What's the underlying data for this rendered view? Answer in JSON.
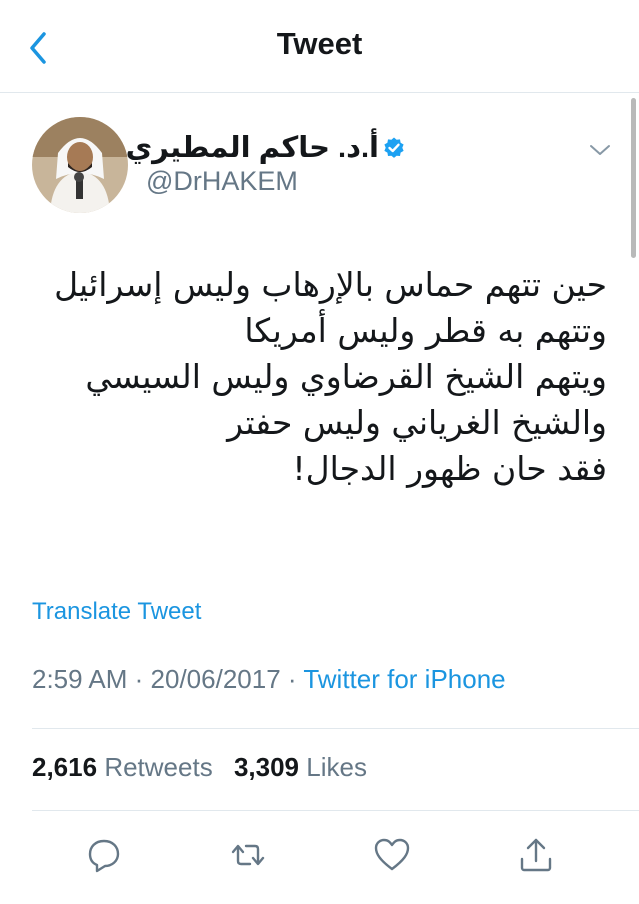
{
  "header": {
    "back_icon": "chevron-left-icon",
    "title": "Tweet"
  },
  "author": {
    "display_name": "أ.د. حاكم المطيري",
    "handle": "@DrHAKEM",
    "verified_icon": "verified-badge-icon"
  },
  "tweet": {
    "lines": [
      "حين تتهم حماس بالإرهاب وليس إسرائيل",
      "وتتهم به قطر وليس أمريكا",
      "ويتهم الشيخ القرضاوي وليس السيسي",
      "والشيخ الغرياني وليس حفتر",
      "فقد حان ظهور الدجال!"
    ],
    "translate_label": "Translate Tweet",
    "time": "2:59 AM",
    "date": "20/06/2017",
    "source": "Twitter for iPhone"
  },
  "stats": {
    "retweets_count": "2,616",
    "retweets_label": "Retweets",
    "likes_count": "3,309",
    "likes_label": "Likes"
  },
  "actions": [
    "reply-icon",
    "retweet-icon",
    "like-icon",
    "share-icon"
  ],
  "colors": {
    "accent": "#1b95e0",
    "text": "#14171a",
    "secondary": "#657786",
    "divider": "#e1e8ed"
  }
}
